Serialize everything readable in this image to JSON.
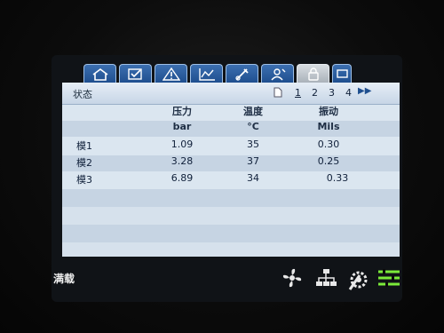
{
  "tabs": [
    {
      "icon": "home-icon"
    },
    {
      "icon": "checklist-icon"
    },
    {
      "icon": "warning-icon"
    },
    {
      "icon": "trend-chart-icon"
    },
    {
      "icon": "tools-icon"
    },
    {
      "icon": "operator-icon"
    },
    {
      "icon": "lock-icon",
      "active": true
    },
    {
      "icon": "monitor-icon"
    }
  ],
  "panel": {
    "title": "状态",
    "pages": [
      "1",
      "2",
      "3",
      "4"
    ],
    "current_page": "1"
  },
  "table": {
    "headers": [
      "压力",
      "温度",
      "振动"
    ],
    "units": [
      "bar",
      "°C",
      "Mils"
    ],
    "rows": [
      {
        "label": "模1",
        "pressure": "1.09",
        "temperature": "35",
        "vibration": "0.30"
      },
      {
        "label": "模2",
        "pressure": "3.28",
        "temperature": "37",
        "vibration": "0.25"
      },
      {
        "label": "模3",
        "pressure": "6.89",
        "temperature": "34",
        "vibration": "0.33"
      }
    ]
  },
  "status": {
    "text": "满载",
    "icons": [
      "fan-icon",
      "network-icon",
      "maintenance-icon",
      "menu-icon"
    ],
    "accent": "#7bea3a"
  }
}
